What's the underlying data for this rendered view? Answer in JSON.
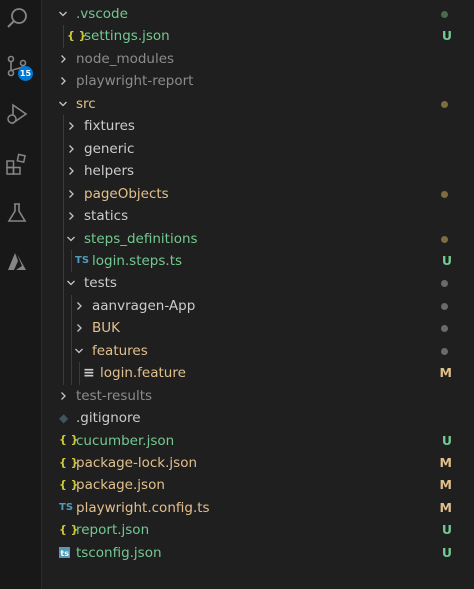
{
  "colors": {
    "untracked": "#73c991",
    "modified": "#e2c08d",
    "ignored": "#8c8c8c",
    "default": "#cccccc",
    "dot_green": "#4b6a4f",
    "dot_gold": "#7d6c40",
    "dot_gray": "#6a6a6a",
    "json_icon": "#cbcb41",
    "ts_icon": "#519aba",
    "accent_badge": "#0078d4"
  },
  "activity_bar": {
    "source_control_badge": "15"
  },
  "tree": [
    {
      "label": ".vscode",
      "type": "folder",
      "open": true,
      "depth": 0,
      "color": "untracked",
      "indicator": "dot",
      "dot": "dot_green"
    },
    {
      "label": "settings.json",
      "type": "json",
      "icon_text": "{ }",
      "depth": 1,
      "color": "untracked",
      "status": "U"
    },
    {
      "label": "node_modules",
      "type": "folder",
      "open": false,
      "depth": 0,
      "color": "ignored"
    },
    {
      "label": "playwright-report",
      "type": "folder",
      "open": false,
      "depth": 0,
      "color": "ignored"
    },
    {
      "label": "src",
      "type": "folder",
      "open": true,
      "depth": 0,
      "color": "modified",
      "indicator": "dot",
      "dot": "dot_gold"
    },
    {
      "label": "fixtures",
      "type": "folder",
      "open": false,
      "depth": 1,
      "color": "default"
    },
    {
      "label": "generic",
      "type": "folder",
      "open": false,
      "depth": 1,
      "color": "default"
    },
    {
      "label": "helpers",
      "type": "folder",
      "open": false,
      "depth": 1,
      "color": "default"
    },
    {
      "label": "pageObjects",
      "type": "folder",
      "open": false,
      "depth": 1,
      "color": "modified",
      "indicator": "dot",
      "dot": "dot_gold"
    },
    {
      "label": "statics",
      "type": "folder",
      "open": false,
      "depth": 1,
      "color": "default"
    },
    {
      "label": "steps_definitions",
      "type": "folder",
      "open": true,
      "depth": 1,
      "color": "untracked",
      "indicator": "dot",
      "dot": "dot_gold"
    },
    {
      "label": "login.steps.ts",
      "type": "ts",
      "icon_text": "TS",
      "depth": 2,
      "color": "untracked",
      "status": "U"
    },
    {
      "label": "tests",
      "type": "folder",
      "open": true,
      "depth": 1,
      "color": "default",
      "indicator": "dot",
      "dot": "dot_gray"
    },
    {
      "label": "aanvragen-App",
      "type": "folder",
      "open": false,
      "depth": 2,
      "color": "default",
      "indicator": "dot",
      "dot": "dot_gray"
    },
    {
      "label": "BUK",
      "type": "folder",
      "open": false,
      "depth": 2,
      "color": "modified",
      "indicator": "dot",
      "dot": "dot_gray"
    },
    {
      "label": "features",
      "type": "folder",
      "open": true,
      "depth": 2,
      "color": "modified",
      "indicator": "dot",
      "dot": "dot_gray"
    },
    {
      "label": "login.feature",
      "type": "feature",
      "icon_text": "≡",
      "depth": 3,
      "color": "modified",
      "status": "M"
    },
    {
      "label": "test-results",
      "type": "folder",
      "open": false,
      "depth": 0,
      "color": "ignored"
    },
    {
      "label": ".gitignore",
      "type": "gitignore",
      "icon_text": "◆",
      "depth": 0,
      "color": "default"
    },
    {
      "label": "cucumber.json",
      "type": "json",
      "icon_text": "{ }",
      "depth": 0,
      "color": "untracked",
      "status": "U"
    },
    {
      "label": "package-lock.json",
      "type": "json",
      "icon_text": "{ }",
      "depth": 0,
      "color": "modified",
      "status": "M"
    },
    {
      "label": "package.json",
      "type": "json",
      "icon_text": "{ }",
      "depth": 0,
      "color": "modified",
      "status": "M"
    },
    {
      "label": "playwright.config.ts",
      "type": "ts",
      "icon_text": "TS",
      "depth": 0,
      "color": "modified",
      "status": "M"
    },
    {
      "label": "report.json",
      "type": "json",
      "icon_text": "{ }",
      "depth": 0,
      "color": "untracked",
      "status": "U"
    },
    {
      "label": "tsconfig.json",
      "type": "tsconfig",
      "icon_text": "ts",
      "depth": 0,
      "color": "untracked",
      "status": "U"
    }
  ]
}
